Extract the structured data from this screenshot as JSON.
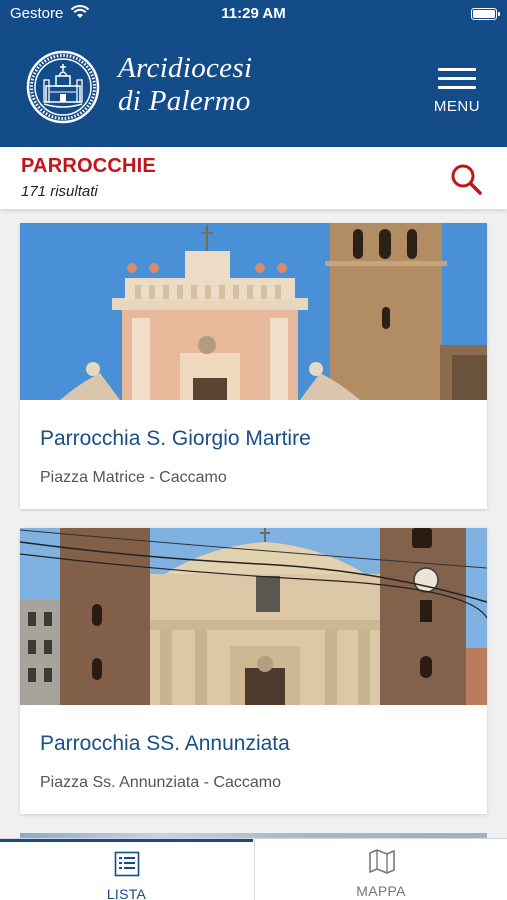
{
  "status_bar": {
    "carrier": "Gestore",
    "time": "11:29 AM"
  },
  "header": {
    "brand_line1": "Arcidiocesi",
    "brand_line2": "di Palermo",
    "menu_label": "MENU"
  },
  "section": {
    "title": "PARROCCHIE",
    "results": "171 risultati"
  },
  "parishes": [
    {
      "name": "Parrocchia S. Giorgio Martire",
      "address": "Piazza Matrice - Caccamo"
    },
    {
      "name": "Parrocchia SS. Annunziata",
      "address": "Piazza Ss. Annunziata - Caccamo"
    }
  ],
  "tabs": [
    {
      "label": "LISTA",
      "icon": "list-icon",
      "active": true
    },
    {
      "label": "MAPPA",
      "icon": "map-icon",
      "active": false
    }
  ],
  "colors": {
    "brand_blue": "#144c8a",
    "accent_red": "#c0161b",
    "link_blue": "#1a4f86"
  }
}
